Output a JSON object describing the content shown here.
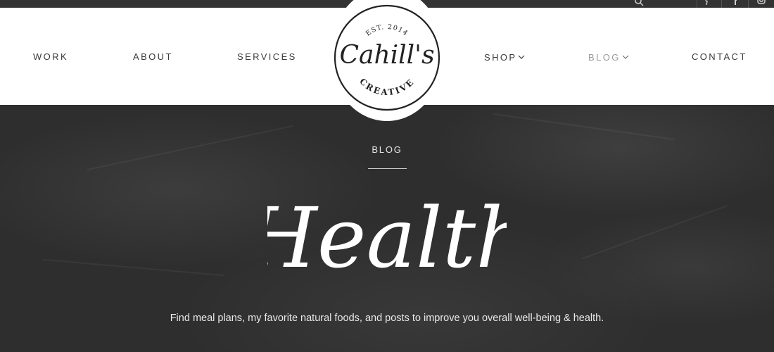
{
  "nav": {
    "left": [
      {
        "label": "WORK"
      },
      {
        "label": "ABOUT"
      },
      {
        "label": "SERVICES"
      }
    ],
    "right": [
      {
        "label": "SHOP",
        "has_dropdown": true
      },
      {
        "label": "BLOG",
        "has_dropdown": true,
        "active": true
      },
      {
        "label": "CONTACT"
      }
    ],
    "active_color": "#9a9a9a"
  },
  "logo": {
    "est": "EST. 2014",
    "name": "Cahill's",
    "tagline": "CREATIVE"
  },
  "topbar": {
    "icons": [
      "search-icon",
      "pinterest-icon",
      "facebook-icon",
      "instagram-icon"
    ]
  },
  "hero": {
    "eyebrow": "BLOG",
    "title": "Health",
    "description": "Find meal plans, my favorite natural foods, and posts to improve you overall well-being & health."
  }
}
